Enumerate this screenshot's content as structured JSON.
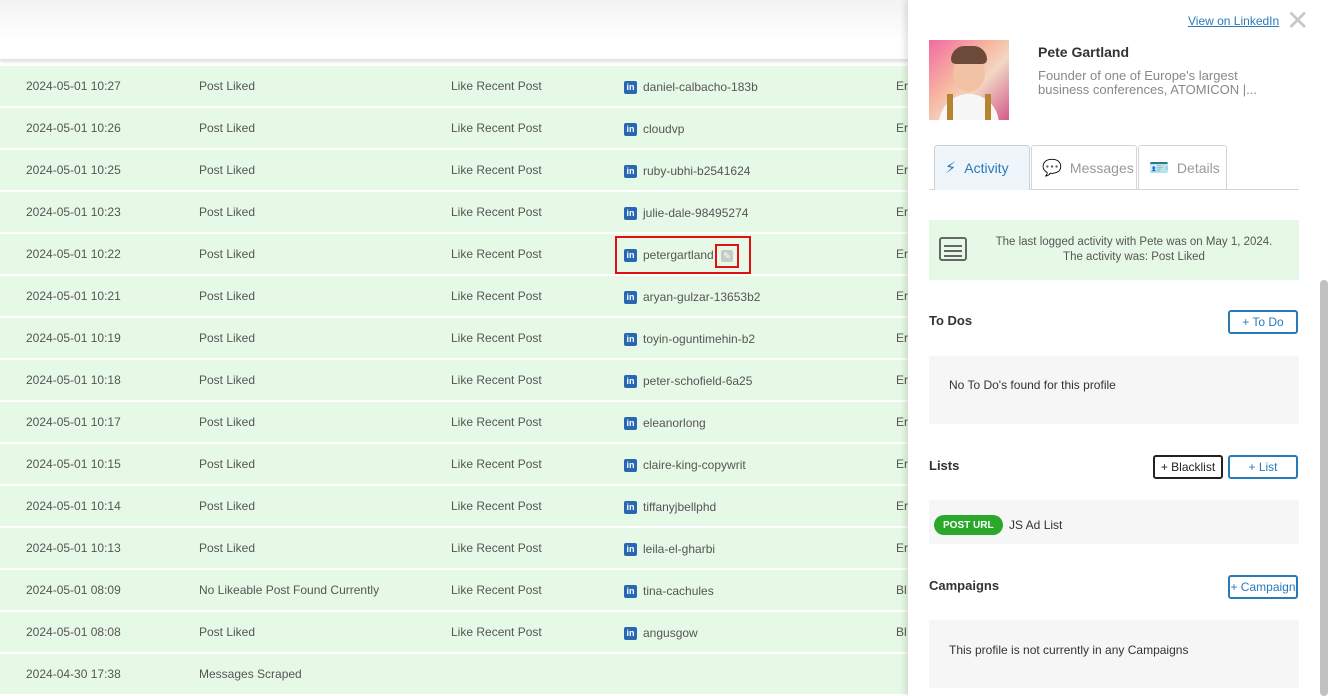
{
  "rows": [
    {
      "date": "2024-05-01 10:27",
      "status": "Post Liked",
      "action": "Like Recent Post",
      "profile": "daniel-calbacho-183b",
      "extra": "Er"
    },
    {
      "date": "2024-05-01 10:26",
      "status": "Post Liked",
      "action": "Like Recent Post",
      "profile": "cloudvp",
      "extra": "Er"
    },
    {
      "date": "2024-05-01 10:25",
      "status": "Post Liked",
      "action": "Like Recent Post",
      "profile": "ruby-ubhi-b2541624",
      "extra": "Er"
    },
    {
      "date": "2024-05-01 10:23",
      "status": "Post Liked",
      "action": "Like Recent Post",
      "profile": "julie-dale-98495274",
      "extra": "Er"
    },
    {
      "date": "2024-05-01 10:22",
      "status": "Post Liked",
      "action": "Like Recent Post",
      "profile": "petergartland",
      "extra": "Er"
    },
    {
      "date": "2024-05-01 10:21",
      "status": "Post Liked",
      "action": "Like Recent Post",
      "profile": "aryan-gulzar-13653b2",
      "extra": "Er"
    },
    {
      "date": "2024-05-01 10:19",
      "status": "Post Liked",
      "action": "Like Recent Post",
      "profile": "toyin-oguntimehin-b2",
      "extra": "Er"
    },
    {
      "date": "2024-05-01 10:18",
      "status": "Post Liked",
      "action": "Like Recent Post",
      "profile": "peter-schofield-6a25",
      "extra": "Er"
    },
    {
      "date": "2024-05-01 10:17",
      "status": "Post Liked",
      "action": "Like Recent Post",
      "profile": "eleanorlong",
      "extra": "Er"
    },
    {
      "date": "2024-05-01 10:15",
      "status": "Post Liked",
      "action": "Like Recent Post",
      "profile": "claire-king-copywrit",
      "extra": "Er"
    },
    {
      "date": "2024-05-01 10:14",
      "status": "Post Liked",
      "action": "Like Recent Post",
      "profile": "tiffanyjbellphd",
      "extra": "Er"
    },
    {
      "date": "2024-05-01 10:13",
      "status": "Post Liked",
      "action": "Like Recent Post",
      "profile": "leila-el-gharbi",
      "extra": "Er"
    },
    {
      "date": "2024-05-01 08:09",
      "status": "No Likeable Post Found Currently",
      "action": "Like Recent Post",
      "profile": "tina-cachules",
      "extra": "Bl"
    },
    {
      "date": "2024-05-01 08:08",
      "status": "Post Liked",
      "action": "Like Recent Post",
      "profile": "angusgow",
      "extra": "Bl"
    },
    {
      "date": "2024-04-30 17:38",
      "status": "Messages Scraped",
      "action": "",
      "profile": "",
      "extra": ""
    }
  ],
  "panel": {
    "view_linkedin": "View on LinkedIn",
    "close_symbol": "✕",
    "name": "Pete Gartland",
    "headline": "Founder of one of Europe's largest business conferences, ATOMICON |...",
    "tabs": [
      {
        "label": "Activity",
        "icon": "⚡"
      },
      {
        "label": "Messages",
        "icon": "💬"
      },
      {
        "label": "Details",
        "icon": "🪪"
      }
    ],
    "notice_line1": "The last logged activity with Pete was on May 1, 2024.",
    "notice_line2": "The activity was: Post Liked",
    "todos_title": "To Dos",
    "todo_button": "+ To Do",
    "todos_empty": "No To Do's found for this profile",
    "lists_title": "Lists",
    "blacklist_button": "+ Blacklist",
    "list_button": "+ List",
    "list_badge": "POST URL",
    "list_name": "JS Ad List",
    "campaigns_title": "Campaigns",
    "campaign_button": "+ Campaign",
    "campaigns_empty": "This profile is not currently in any Campaigns"
  },
  "colors": {
    "row_bg": "#e6f9e6",
    "accent": "#2a7ab8",
    "highlight": "#e01010",
    "badge": "#2aa82a"
  }
}
